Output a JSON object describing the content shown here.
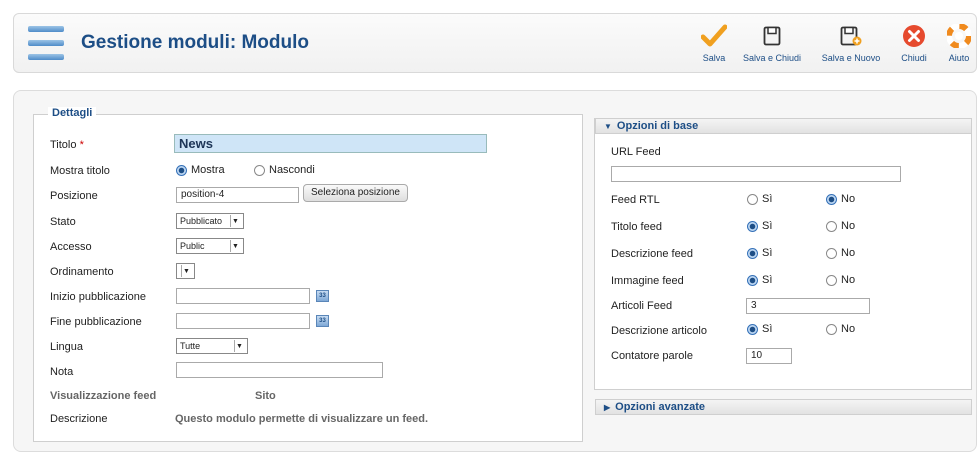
{
  "toolbar": {
    "title": "Gestione moduli: Modulo",
    "buttons": [
      {
        "label": "Salva",
        "icon": "check-icon"
      },
      {
        "label": "Salva e Chiudi",
        "icon": "save-icon"
      },
      {
        "label": "Salva e Nuovo",
        "icon": "save-new-icon"
      },
      {
        "label": "Chiudi",
        "icon": "close-icon"
      },
      {
        "label": "Aiuto",
        "icon": "help-icon"
      }
    ]
  },
  "details": {
    "legend": "Dettagli",
    "titolo": {
      "label": "Titolo",
      "required_mark": "*",
      "value": "News"
    },
    "mostra_titolo": {
      "label": "Mostra titolo",
      "option_show": "Mostra",
      "option_hide": "Nascondi",
      "selected": "Mostra"
    },
    "posizione": {
      "label": "Posizione",
      "value": "position-4",
      "button": "Seleziona posizione"
    },
    "stato": {
      "label": "Stato",
      "value": "Pubblicato"
    },
    "accesso": {
      "label": "Accesso",
      "value": "Public"
    },
    "ordinamento": {
      "label": "Ordinamento",
      "value": ""
    },
    "inizio": {
      "label": "Inizio pubblicazione",
      "value": ""
    },
    "fine": {
      "label": "Fine pubblicazione",
      "value": ""
    },
    "lingua": {
      "label": "Lingua",
      "value": "Tutte"
    },
    "nota": {
      "label": "Nota",
      "value": ""
    },
    "visualizzazione": {
      "label": "Visualizzazione feed",
      "value": "Sito"
    },
    "descrizione": {
      "label": "Descrizione",
      "value": "Questo modulo permette di visualizzare un feed."
    },
    "calendar_glyph": "33"
  },
  "options": {
    "basic_header": "Opzioni di base",
    "advanced_header": "Opzioni avanzate",
    "url_feed": {
      "label": "URL Feed",
      "value": ""
    },
    "yes": "Sì",
    "no": "No",
    "feed_rtl": {
      "label": "Feed RTL",
      "selected": "No"
    },
    "titolo_feed": {
      "label": "Titolo feed",
      "selected": "Sì"
    },
    "descrizione_feed": {
      "label": "Descrizione feed",
      "selected": "Sì"
    },
    "immagine_feed": {
      "label": "Immagine feed",
      "selected": "Sì"
    },
    "articoli_feed": {
      "label": "Articoli Feed",
      "value": "3"
    },
    "descrizione_articolo": {
      "label": "Descrizione articolo",
      "selected": "Sì"
    },
    "contatore_parole": {
      "label": "Contatore parole",
      "value": "10"
    }
  },
  "colors": {
    "accent": "#1d4e86",
    "check": "#f0a020",
    "close": "#e64a2e"
  }
}
